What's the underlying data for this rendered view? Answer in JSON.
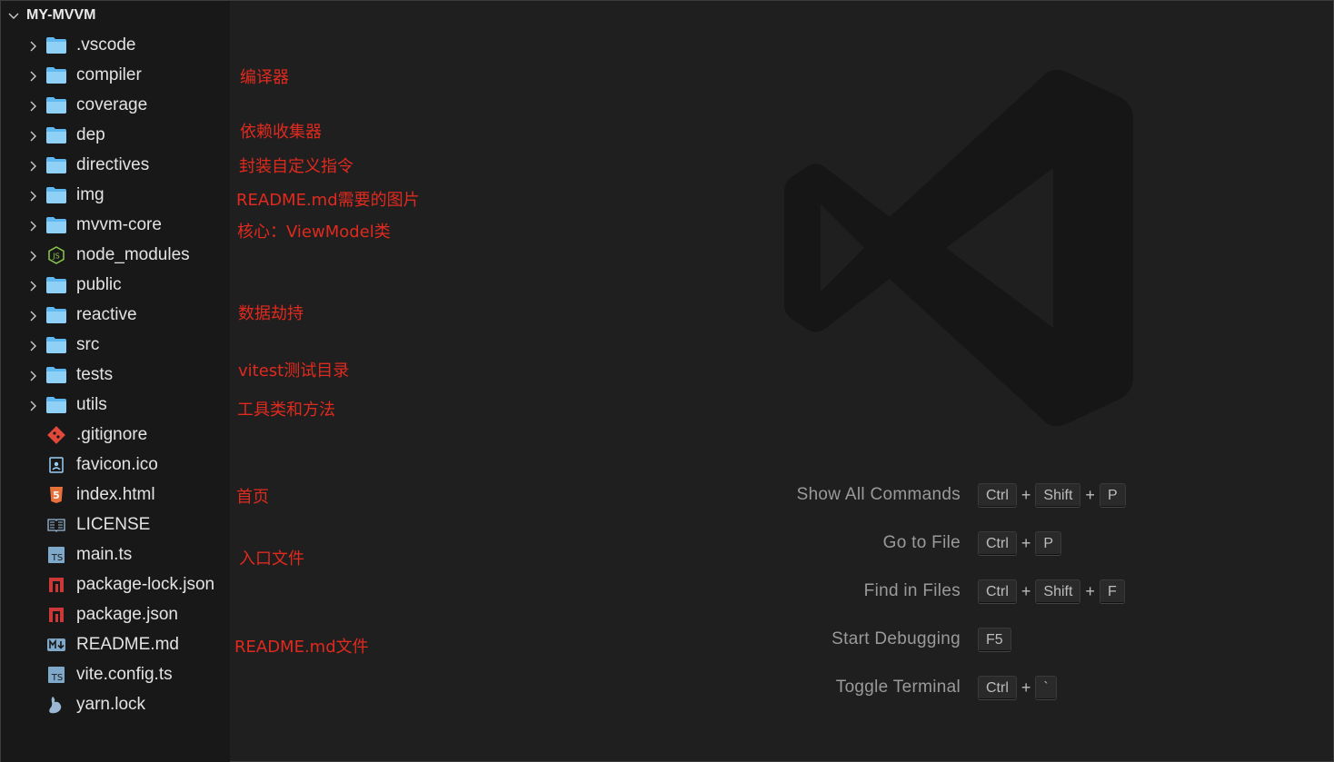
{
  "explorer": {
    "title": "MY-MVVM",
    "items": [
      {
        "label": ".vscode",
        "icon": "folder-icon",
        "type": "folder"
      },
      {
        "label": "compiler",
        "icon": "folder-icon",
        "type": "folder"
      },
      {
        "label": "coverage",
        "icon": "folder-icon",
        "type": "folder"
      },
      {
        "label": "dep",
        "icon": "folder-icon",
        "type": "folder"
      },
      {
        "label": "directives",
        "icon": "folder-icon",
        "type": "folder"
      },
      {
        "label": "img",
        "icon": "folder-icon",
        "type": "folder"
      },
      {
        "label": "mvvm-core",
        "icon": "folder-icon",
        "type": "folder"
      },
      {
        "label": "node_modules",
        "icon": "nodejs-icon",
        "type": "folder"
      },
      {
        "label": "public",
        "icon": "folder-icon",
        "type": "folder"
      },
      {
        "label": "reactive",
        "icon": "folder-icon",
        "type": "folder"
      },
      {
        "label": "src",
        "icon": "folder-icon",
        "type": "folder"
      },
      {
        "label": "tests",
        "icon": "folder-icon",
        "type": "folder"
      },
      {
        "label": "utils",
        "icon": "folder-icon",
        "type": "folder"
      },
      {
        "label": ".gitignore",
        "icon": "git-icon",
        "type": "file"
      },
      {
        "label": "favicon.ico",
        "icon": "image-file-icon",
        "type": "file"
      },
      {
        "label": "index.html",
        "icon": "html5-icon",
        "type": "file"
      },
      {
        "label": "LICENSE",
        "icon": "license-icon",
        "type": "file"
      },
      {
        "label": "main.ts",
        "icon": "typescript-icon",
        "type": "file"
      },
      {
        "label": "package-lock.json",
        "icon": "npm-icon",
        "type": "file"
      },
      {
        "label": "package.json",
        "icon": "npm-icon",
        "type": "file"
      },
      {
        "label": "README.md",
        "icon": "markdown-icon",
        "type": "file"
      },
      {
        "label": "vite.config.ts",
        "icon": "typescript-icon",
        "type": "file"
      },
      {
        "label": "yarn.lock",
        "icon": "yarn-icon",
        "type": "file"
      }
    ]
  },
  "annotations": [
    {
      "text": "编译器"
    },
    {
      "text": "依赖收集器"
    },
    {
      "text": "封装自定义指令"
    },
    {
      "text": "README.md需要的图片"
    },
    {
      "text": "核心：ViewModel类"
    },
    {
      "text": "数据劫持"
    },
    {
      "text": "vitest测试目录"
    },
    {
      "text": "工具类和方法"
    },
    {
      "text": "首页"
    },
    {
      "text": "入口文件"
    },
    {
      "text": "README.md文件"
    }
  ],
  "shortcuts": [
    {
      "label": "Show All Commands",
      "keys": [
        "Ctrl",
        "Shift",
        "P"
      ]
    },
    {
      "label": "Go to File",
      "keys": [
        "Ctrl",
        "P"
      ]
    },
    {
      "label": "Find in Files",
      "keys": [
        "Ctrl",
        "Shift",
        "F"
      ]
    },
    {
      "label": "Start Debugging",
      "keys": [
        "F5"
      ]
    },
    {
      "label": "Toggle Terminal",
      "keys": [
        "Ctrl",
        "`"
      ]
    }
  ],
  "colors": {
    "annotation": "#e02a1f",
    "folder": "#5fb8f0",
    "background": "#1f1f1f",
    "sidebar": "#181818"
  }
}
